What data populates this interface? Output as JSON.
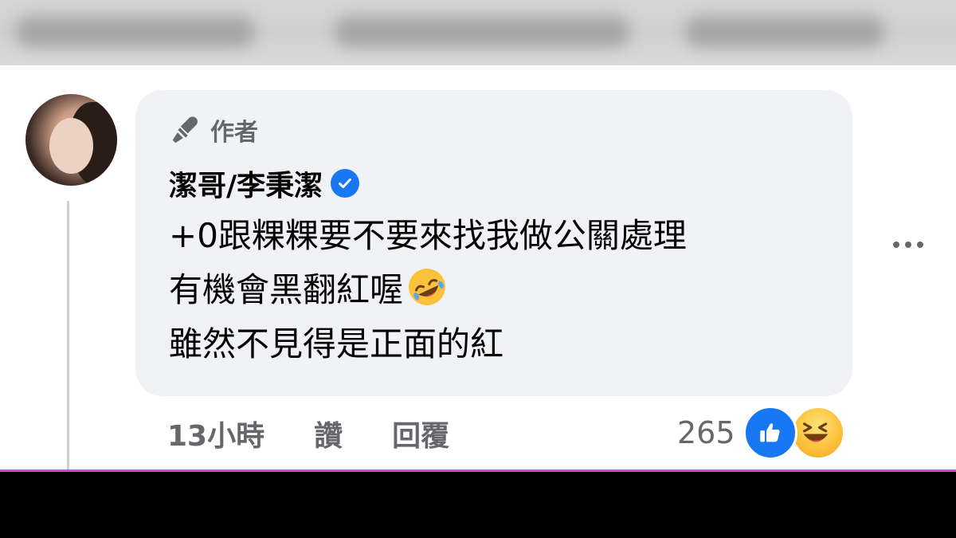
{
  "comment": {
    "author_badge": "作者",
    "author_name": "潔哥/李秉潔",
    "verified": true,
    "lines": [
      "+0跟粿粿要不要來找我做公關處理",
      "有機會黑翻紅喔",
      "雖然不見得是正面的紅"
    ],
    "inline_emoji": "rolling-on-floor-laughing",
    "time": "13小時",
    "like_label": "讚",
    "reply_label": "回覆",
    "reaction_count": "265",
    "reactions": [
      "like",
      "haha"
    ]
  },
  "colors": {
    "bubble": "#f0f2f5",
    "text": "#050505",
    "secondary_text": "#65676b",
    "brand_blue": "#1877f2",
    "bottom_bar": "#000000",
    "accent_line": "#e93dd1"
  }
}
